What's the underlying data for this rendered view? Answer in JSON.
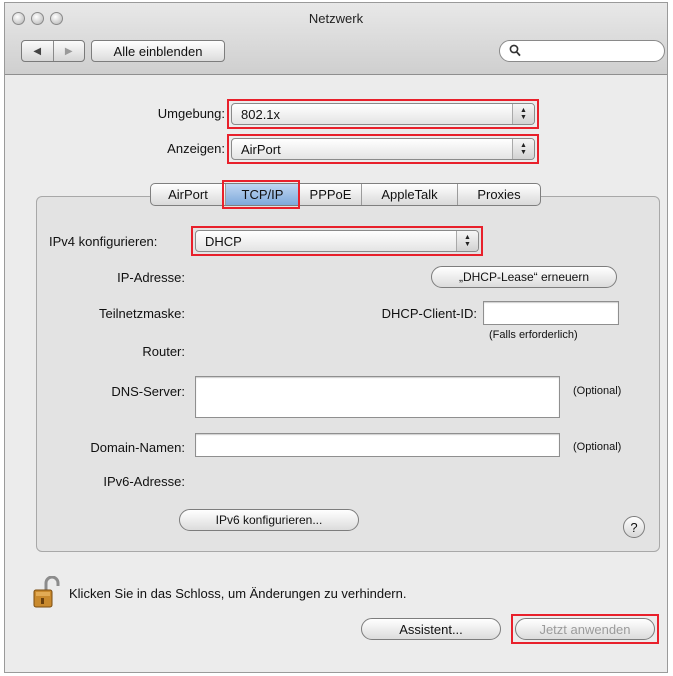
{
  "window": {
    "title": "Netzwerk"
  },
  "toolbar": {
    "show_all_label": "Alle einblenden",
    "back_glyph": "◀",
    "forward_glyph": "▶",
    "search_placeholder": ""
  },
  "location": {
    "label": "Umgebung:",
    "value": "802.1x"
  },
  "show": {
    "label": "Anzeigen:",
    "value": "AirPort"
  },
  "tabs": [
    {
      "label": "AirPort"
    },
    {
      "label": "TCP/IP"
    },
    {
      "label": "PPPoE"
    },
    {
      "label": "AppleTalk"
    },
    {
      "label": "Proxies"
    }
  ],
  "active_tab": "TCP/IP",
  "ipv4": {
    "label": "IPv4 konfigurieren:",
    "value": "DHCP"
  },
  "fields": {
    "ip_label": "IP-Adresse:",
    "subnet_label": "Teilnetzmaske:",
    "router_label": "Router:",
    "renew_button": "„DHCP-Lease“ erneuern",
    "client_id_label": "DHCP-Client-ID:",
    "client_id_value": "",
    "client_id_hint": "(Falls erforderlich)",
    "dns_label": "DNS-Server:",
    "dns_value": "",
    "dns_hint": "(Optional)",
    "domain_label": "Domain-Namen:",
    "domain_value": "",
    "domain_hint": "(Optional)",
    "ipv6_label": "IPv6-Adresse:",
    "ipv6_button": "IPv6 konfigurieren...",
    "help_glyph": "?"
  },
  "footer": {
    "lock_text": "Klicken Sie in das Schloss, um Änderungen zu verhindern.",
    "assistant_button": "Assistent...",
    "apply_button": "Jetzt anwenden"
  },
  "colors": {
    "highlight": "#e8202b",
    "active_tab": "#7ea9db"
  },
  "icons": {
    "search": "search-icon",
    "lock": "lock-icon",
    "help": "help-icon"
  }
}
